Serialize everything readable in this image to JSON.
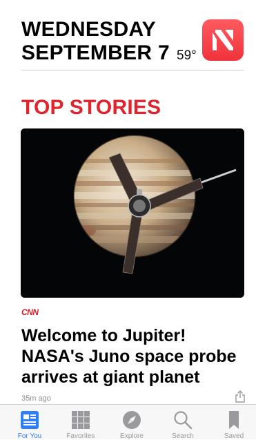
{
  "header": {
    "day": "WEDNESDAY",
    "date": "SEPTEMBER 7",
    "temperature": "59°",
    "app_icon": "apple-news-icon"
  },
  "section": {
    "title": "TOP STORIES"
  },
  "story": {
    "source": "CNN",
    "headline": "Welcome to Jupiter! NASA's Juno space probe arrives at giant planet",
    "time": "35m ago",
    "share_icon": "share-icon"
  },
  "tabs": [
    {
      "label": "For You",
      "icon": "newspaper-icon",
      "active": true
    },
    {
      "label": "Favorites",
      "icon": "grid-icon",
      "active": false
    },
    {
      "label": "Explore",
      "icon": "compass-icon",
      "active": false
    },
    {
      "label": "Search",
      "icon": "search-icon",
      "active": false
    },
    {
      "label": "Saved",
      "icon": "bookmark-icon",
      "active": false
    }
  ],
  "colors": {
    "accent_red": "#e0242b",
    "tab_active_blue": "#2f7ef6",
    "tab_inactive_gray": "#9a9a9e"
  }
}
